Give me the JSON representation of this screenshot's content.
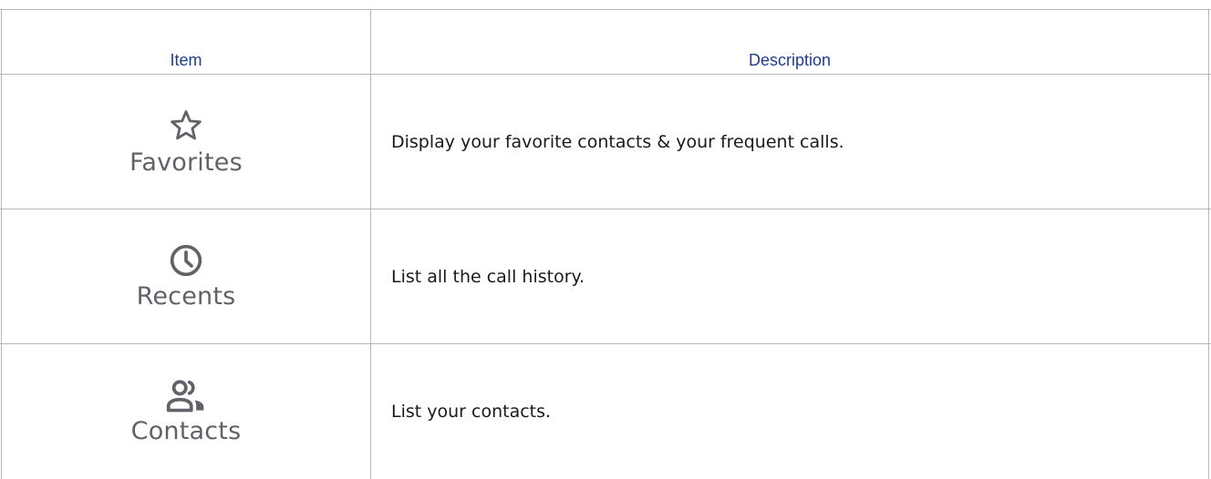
{
  "table": {
    "headers": {
      "item": "Item",
      "description": "Description"
    },
    "rows": [
      {
        "icon": "star-outline-icon",
        "label": "Favorites",
        "description": "Display your favorite contacts & your frequent calls."
      },
      {
        "icon": "clock-icon",
        "label": "Recents",
        "description": "List all the call history."
      },
      {
        "icon": "people-icon",
        "label": "Contacts",
        "description": "List your contacts."
      }
    ]
  },
  "colors": {
    "header_text": "#1f3d8f",
    "icon_and_label": "#5f6368",
    "grid_lines": "#b8b8b8"
  }
}
